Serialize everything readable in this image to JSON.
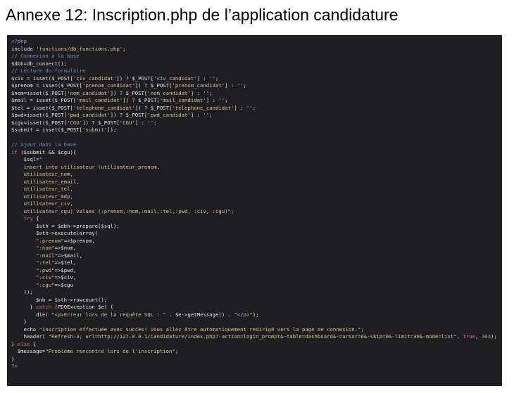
{
  "document": {
    "title": "Annexe 12: Inscription.php de l’application candidature"
  },
  "code": {
    "language": "php",
    "lines": [
      [
        {
          "t": "tag",
          "v": "<?php"
        }
      ],
      [
        {
          "t": "txt",
          "v": "include "
        },
        {
          "t": "str",
          "v": "'functions/db_functions.php'"
        },
        {
          "t": "txt",
          "v": ";"
        }
      ],
      [
        {
          "t": "cm",
          "v": "// Connexion à la base"
        }
      ],
      [
        {
          "t": "txt",
          "v": "$dbh=db_connect();"
        }
      ],
      [
        {
          "t": "cm",
          "v": "// Lecture du formulaire"
        }
      ],
      [
        {
          "t": "txt",
          "v": "$civ = isset($_POST["
        },
        {
          "t": "str",
          "v": "'civ_candidat'"
        },
        {
          "t": "txt",
          "v": "]) ? $_POST["
        },
        {
          "t": "str",
          "v": "'civ_candidat'"
        },
        {
          "t": "txt",
          "v": "] : "
        },
        {
          "t": "str",
          "v": "''"
        },
        {
          "t": "txt",
          "v": ";"
        }
      ],
      [
        {
          "t": "txt",
          "v": "$prenom = isset($_POST["
        },
        {
          "t": "str",
          "v": "'prenom_candidat'"
        },
        {
          "t": "txt",
          "v": "]) ? $_POST["
        },
        {
          "t": "str",
          "v": "'prenom_candidat'"
        },
        {
          "t": "txt",
          "v": "] : "
        },
        {
          "t": "str",
          "v": "''"
        },
        {
          "t": "txt",
          "v": ";"
        }
      ],
      [
        {
          "t": "txt",
          "v": "$nom=isset($_POST["
        },
        {
          "t": "str",
          "v": "'nom_candidat'"
        },
        {
          "t": "txt",
          "v": "]) ? $_POST["
        },
        {
          "t": "str",
          "v": "'nom_candidat'"
        },
        {
          "t": "txt",
          "v": "] : "
        },
        {
          "t": "str",
          "v": "''"
        },
        {
          "t": "txt",
          "v": ";"
        }
      ],
      [
        {
          "t": "txt",
          "v": "$mail = isset($_POST["
        },
        {
          "t": "str",
          "v": "'mail_candidat'"
        },
        {
          "t": "txt",
          "v": "]) ? $_POST["
        },
        {
          "t": "str",
          "v": "'mail_candidat'"
        },
        {
          "t": "txt",
          "v": "] : "
        },
        {
          "t": "str",
          "v": "''"
        },
        {
          "t": "txt",
          "v": ";"
        }
      ],
      [
        {
          "t": "txt",
          "v": "$tel = isset($_POST["
        },
        {
          "t": "str",
          "v": "'telephone_candidat'"
        },
        {
          "t": "txt",
          "v": "]) ? $_POST["
        },
        {
          "t": "str",
          "v": "'telephone_candidat'"
        },
        {
          "t": "txt",
          "v": "] : "
        },
        {
          "t": "str",
          "v": "''"
        },
        {
          "t": "txt",
          "v": ";"
        }
      ],
      [
        {
          "t": "txt",
          "v": "$pwd=isset($_POST["
        },
        {
          "t": "str",
          "v": "'pwd_candidat'"
        },
        {
          "t": "txt",
          "v": "]) ? $_POST["
        },
        {
          "t": "str",
          "v": "'pwd_candidat'"
        },
        {
          "t": "txt",
          "v": "] : "
        },
        {
          "t": "str",
          "v": "''"
        },
        {
          "t": "txt",
          "v": ";"
        }
      ],
      [
        {
          "t": "txt",
          "v": "$cgu=isset($_POST["
        },
        {
          "t": "str",
          "v": "'CGU'"
        },
        {
          "t": "txt",
          "v": "]) ? $_POST["
        },
        {
          "t": "str",
          "v": "'CGU'"
        },
        {
          "t": "txt",
          "v": "] : "
        },
        {
          "t": "str",
          "v": "''"
        },
        {
          "t": "txt",
          "v": ";"
        }
      ],
      [
        {
          "t": "txt",
          "v": "$submit = isset($_POST["
        },
        {
          "t": "str",
          "v": "'submit'"
        },
        {
          "t": "txt",
          "v": "]);"
        }
      ],
      [
        {
          "t": "txt",
          "v": ""
        }
      ],
      [
        {
          "t": "cm",
          "v": "// Ajout dans la base"
        }
      ],
      [
        {
          "t": "kw",
          "v": "if"
        },
        {
          "t": "txt",
          "v": " ($submit && $cgu){"
        }
      ],
      [
        {
          "t": "txt",
          "v": "    $sql="
        },
        {
          "t": "str",
          "v": "\""
        }
      ],
      [
        {
          "t": "str",
          "v": "    insert into utilisateur (utilisateur_prenom,"
        }
      ],
      [
        {
          "t": "str",
          "v": "    utilisateur_nom,"
        }
      ],
      [
        {
          "t": "str",
          "v": "    utilisateur_email,"
        }
      ],
      [
        {
          "t": "str",
          "v": "    utilisateur_tel,"
        }
      ],
      [
        {
          "t": "str",
          "v": "    utilisateur_mdp,"
        }
      ],
      [
        {
          "t": "str",
          "v": "    utilisateur_civ,"
        }
      ],
      [
        {
          "t": "str",
          "v": "    utilisateur_cgu) values (:prenom,:nom,:mail,:tel,:pwd, :civ, :cgu)\""
        },
        {
          "t": "txt",
          "v": ";"
        }
      ],
      [
        {
          "t": "kw",
          "v": "    try"
        },
        {
          "t": "txt",
          "v": " {"
        }
      ],
      [
        {
          "t": "txt",
          "v": "        $sth = $dbh->prepare($sql);"
        }
      ],
      [
        {
          "t": "txt",
          "v": "        $sth->execute(array("
        }
      ],
      [
        {
          "t": "str",
          "v": "        \":prenom\""
        },
        {
          "t": "txt",
          "v": "=>$prenom,"
        }
      ],
      [
        {
          "t": "str",
          "v": "        \":nom\""
        },
        {
          "t": "txt",
          "v": "=>$nom,"
        }
      ],
      [
        {
          "t": "str",
          "v": "        \":mail\""
        },
        {
          "t": "txt",
          "v": "=>$mail,"
        }
      ],
      [
        {
          "t": "str",
          "v": "        \":tel\""
        },
        {
          "t": "txt",
          "v": "=>$tel,"
        }
      ],
      [
        {
          "t": "str",
          "v": "        \":pwd\""
        },
        {
          "t": "txt",
          "v": "=>$pwd,"
        }
      ],
      [
        {
          "t": "str",
          "v": "        \":civ\""
        },
        {
          "t": "txt",
          "v": "=>$civ,"
        }
      ],
      [
        {
          "t": "str",
          "v": "        \":cgu\""
        },
        {
          "t": "txt",
          "v": "=>$cgu"
        }
      ],
      [
        {
          "t": "txt",
          "v": "    ));"
        }
      ],
      [
        {
          "t": "txt",
          "v": "        $nb = $sth->rowcount();"
        }
      ],
      [
        {
          "t": "txt",
          "v": "      } "
        },
        {
          "t": "kw",
          "v": "catch"
        },
        {
          "t": "txt",
          "v": " (PDOException $e) {"
        }
      ],
      [
        {
          "t": "txt",
          "v": "        die( "
        },
        {
          "t": "str",
          "v": "\"<p>Erreur lors de la requête SQL : \""
        },
        {
          "t": "txt",
          "v": " . $e->getMessage() . "
        },
        {
          "t": "str",
          "v": "\"</p>\""
        },
        {
          "t": "txt",
          "v": ");"
        }
      ],
      [
        {
          "t": "txt",
          "v": "    }"
        }
      ],
      [
        {
          "t": "txt",
          "v": "    echo "
        },
        {
          "t": "str",
          "v": "\"Inscription effectuée avec succès! Vous allez être automatiquement redirigé vers la page de connexion.\""
        },
        {
          "t": "txt",
          "v": ";"
        }
      ],
      [
        {
          "t": "txt",
          "v": "    header( "
        },
        {
          "t": "str",
          "v": "\"Refresh:3; url=http://127.0.0.1/Candidature/index.php?-action=login_prompt&-table=dashboard&-cursor=0&-skip=0&-limit=30&-mode=list\""
        },
        {
          "t": "txt",
          "v": ", "
        },
        {
          "t": "kw",
          "v": "true"
        },
        {
          "t": "txt",
          "v": ", "
        },
        {
          "t": "num",
          "v": "303"
        },
        {
          "t": "txt",
          "v": ");"
        }
      ],
      [
        {
          "t": "txt",
          "v": "} "
        },
        {
          "t": "kw",
          "v": "else"
        },
        {
          "t": "txt",
          "v": " {"
        }
      ],
      [
        {
          "t": "txt",
          "v": "  $message="
        },
        {
          "t": "str",
          "v": "\"Problème rencontré lors de l'inscription\""
        },
        {
          "t": "txt",
          "v": ";"
        }
      ],
      [
        {
          "t": "txt",
          "v": "}"
        }
      ],
      [
        {
          "t": "tag",
          "v": "?>"
        }
      ]
    ]
  },
  "colors": {
    "code_background": "#1e1f25",
    "comment": "#6a8fc4",
    "string": "#e5c07b",
    "keyword": "#e06c75"
  }
}
